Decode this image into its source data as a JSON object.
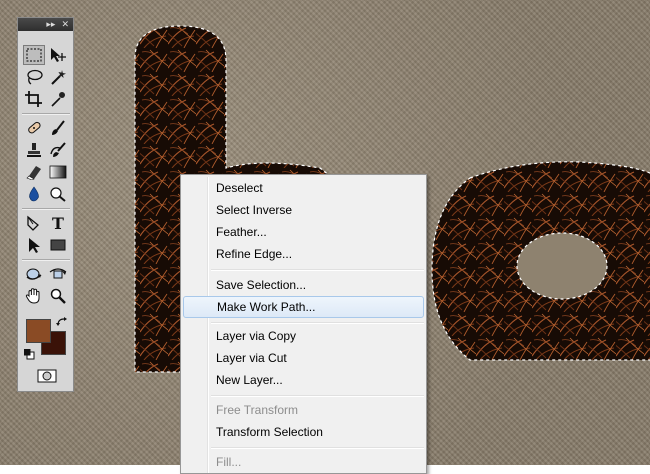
{
  "tools_panel": {
    "collapse_glyph": "▸▸",
    "close_glyph": "✕",
    "tools": [
      {
        "name": "rectangular-marquee-icon"
      },
      {
        "name": "move-icon"
      },
      {
        "name": "lasso-icon"
      },
      {
        "name": "magic-wand-icon"
      },
      {
        "name": "crop-icon"
      },
      {
        "name": "eyedropper-icon"
      },
      {
        "name": "healing-brush-icon"
      },
      {
        "name": "brush-icon"
      },
      {
        "name": "clone-stamp-icon"
      },
      {
        "name": "history-brush-icon"
      },
      {
        "name": "eraser-icon"
      },
      {
        "name": "gradient-icon"
      },
      {
        "name": "blur-icon"
      },
      {
        "name": "dodge-icon"
      },
      {
        "name": "pen-icon"
      },
      {
        "name": "type-icon"
      },
      {
        "name": "path-selection-icon"
      },
      {
        "name": "rectangle-shape-icon"
      },
      {
        "name": "3d-rotate-icon"
      },
      {
        "name": "3d-orbit-icon"
      },
      {
        "name": "hand-icon"
      },
      {
        "name": "zoom-icon"
      }
    ],
    "foreground_color": "#8a4b25",
    "background_color": "#3a1208",
    "type_glyph": "T"
  },
  "context_menu": {
    "items": [
      {
        "label": "Deselect"
      },
      {
        "label": "Select Inverse"
      },
      {
        "label": "Feather..."
      },
      {
        "label": "Refine Edge..."
      },
      {
        "label": "Save Selection..."
      },
      {
        "label": "Make Work Path..."
      },
      {
        "label": "Layer via Copy"
      },
      {
        "label": "Layer via Cut"
      },
      {
        "label": "New Layer..."
      },
      {
        "label": "Free Transform"
      },
      {
        "label": "Transform Selection"
      },
      {
        "label": "Fill..."
      }
    ],
    "hovered_item": "Make Work Path...",
    "disabled_items": [
      "Free Transform",
      "Fill..."
    ]
  }
}
